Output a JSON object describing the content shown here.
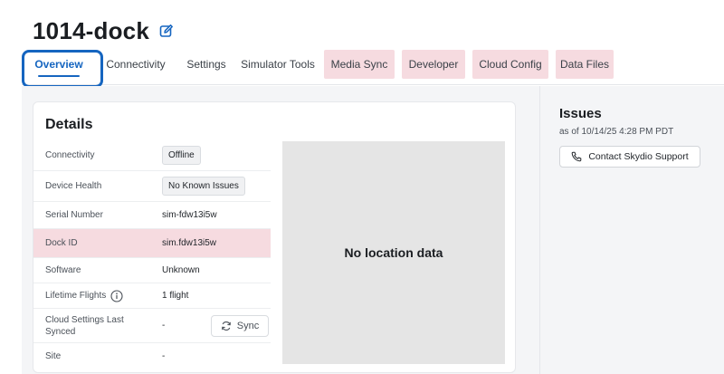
{
  "header": {
    "title": "1014-dock"
  },
  "tabs": [
    {
      "label": "Overview"
    },
    {
      "label": "Connectivity"
    },
    {
      "label": "Settings"
    },
    {
      "label": "Simulator Tools"
    },
    {
      "label": "Media Sync"
    },
    {
      "label": "Developer"
    },
    {
      "label": "Cloud Config"
    },
    {
      "label": "Data Files"
    }
  ],
  "details": {
    "title": "Details",
    "rows": [
      {
        "label": "Connectivity",
        "value": "Offline"
      },
      {
        "label": "Device Health",
        "value": "No Known Issues"
      },
      {
        "label": "Serial Number",
        "value": "sim-fdw13i5w"
      },
      {
        "label": "Dock ID",
        "value": "sim.fdw13i5w"
      },
      {
        "label": "Software",
        "value": "Unknown"
      },
      {
        "label": "Lifetime Flights",
        "value": "1 flight"
      },
      {
        "label": "Cloud Settings Last Synced",
        "value": "-"
      },
      {
        "label": "Site",
        "value": "-"
      }
    ],
    "sync_label": "Sync"
  },
  "map": {
    "empty_text": "No location data"
  },
  "issues": {
    "title": "Issues",
    "timestamp": "as of 10/14/25 4:28 PM PDT",
    "support_label": "Contact Skydio Support"
  },
  "colors": {
    "accent": "#1565c0",
    "highlight": "#f6dbe0",
    "map_bg": "#e5e5e5"
  }
}
